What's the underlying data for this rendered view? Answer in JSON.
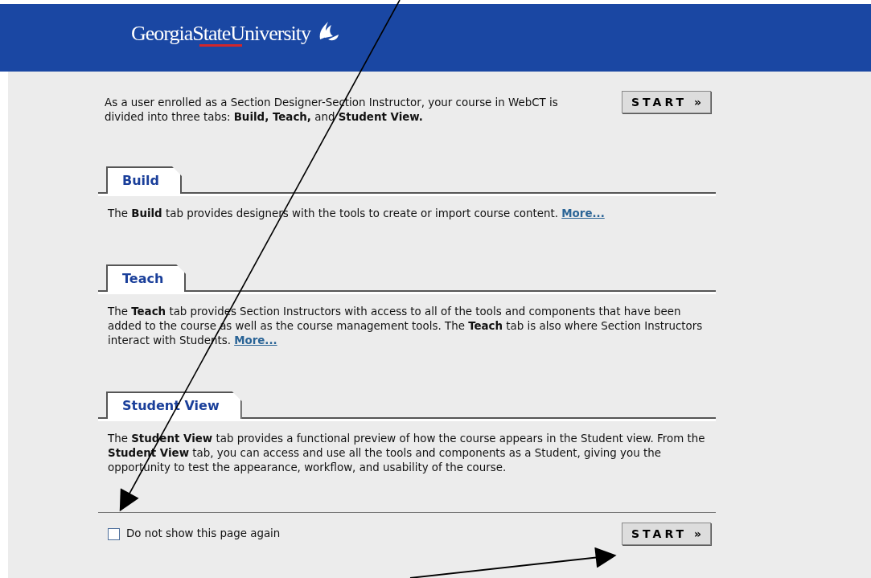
{
  "header": {
    "logo": "GeorgiaStateUniversity"
  },
  "intro": {
    "text": "As a user enrolled as a Section Designer-Section Instructor, your course in WebCT is divided into three tabs: **Build, Teach,** and **Student View.**",
    "button": "START »"
  },
  "sections": [
    {
      "tab": "Build",
      "text": "The **Build** tab provides designers with the tools to create or import course content.",
      "link": "More..."
    },
    {
      "tab": "Teach",
      "text": "The **Teach** tab provides Section Instructors with access to all of the tools and components that have been added to the course as well as the course management tools. The **Teach** tab is also where Section Instructors interact with Students.",
      "link": "More..."
    },
    {
      "tab": "Student View",
      "text": "The **Student View** tab provides a functional preview of how the course appears in the Student view. From the **Student View** tab, you can access and use all the tools and components as a Student, giving you the opportunity to test the appearance, workflow, and usability of the course."
    }
  ],
  "footer": {
    "checkbox": {
      "label": "Do not show this page again",
      "checked": false
    },
    "button": "START »"
  }
}
